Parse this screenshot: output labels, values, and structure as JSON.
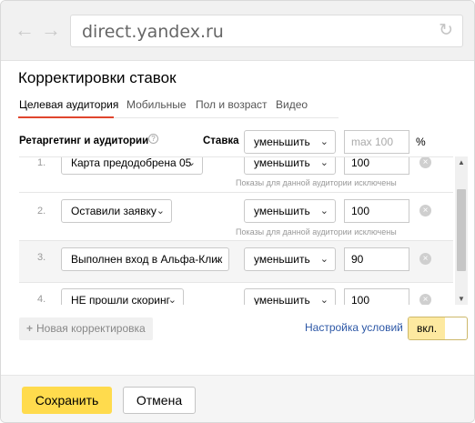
{
  "browser": {
    "back_icon": "arrow-left-icon",
    "forward_icon": "arrow-right-icon",
    "url": "direct.yandex.ru",
    "reload_icon": "reload-icon"
  },
  "dialog": {
    "title": "Корректировки ставок",
    "tabs": [
      {
        "label": "Целевая аудитория",
        "active": true
      },
      {
        "label": "Мобильные",
        "active": false
      },
      {
        "label": "Пол и возраст",
        "active": false
      },
      {
        "label": "Видео",
        "active": false
      }
    ],
    "header": {
      "retargeting_label": "Ретаргетинг и аудитории",
      "help_icon": "?",
      "stavka_label": "Ставка",
      "action_select": "уменьшить",
      "percent_placeholder": "max 100",
      "percent_sign": "%"
    },
    "rows": [
      {
        "num": "1.",
        "audience": "Карта предодобрена 05",
        "action": "уменьшить",
        "value": "100",
        "note": "Показы для данной аудитории исключены"
      },
      {
        "num": "2.",
        "audience": "Оставили заявку",
        "action": "уменьшить",
        "value": "100",
        "note": "Показы для данной аудитории исключены"
      },
      {
        "num": "3.",
        "audience": "Выполнен вход в Альфа-Клик",
        "action": "уменьшить",
        "value": "90",
        "note": ""
      },
      {
        "num": "4.",
        "audience": "НЕ прошли скоринг",
        "action": "уменьшить",
        "value": "100",
        "note": ""
      }
    ],
    "add_button": "Новая корректировка",
    "settings_link": "Настройка условий",
    "toggle_label": "вкл.",
    "toggle_on": true
  },
  "footer": {
    "save": "Сохранить",
    "cancel": "Отмена"
  },
  "colors": {
    "accent_underline": "#e0452d",
    "save_button": "#ffdb4d",
    "link": "#2c57a6",
    "toggle_on": "#fde9a0"
  }
}
